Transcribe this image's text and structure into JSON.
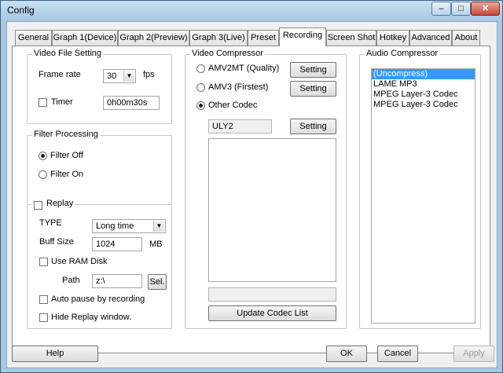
{
  "window": {
    "title": "Config"
  },
  "tabs": [
    "General",
    "Graph 1(Device)",
    "Graph 2(Preview)",
    "Graph 3(Live)",
    "Preset",
    "Recording",
    "Screen Shot",
    "Hotkey",
    "Advanced",
    "About"
  ],
  "active_tab": "Recording",
  "video_file_setting": {
    "legend": "Video File Setting",
    "frame_rate_label": "Frame rate",
    "frame_rate_value": "30",
    "fps_unit": "fps",
    "timer_label": "Timer",
    "timer_checked": false,
    "timer_value": "0h00m30s"
  },
  "filter_processing": {
    "legend": "Filter Processing",
    "filter_off_label": "Filter Off",
    "filter_on_label": "Filter On",
    "selected": "Filter Off"
  },
  "replay": {
    "legend": "Replay",
    "checked": false,
    "type_label": "TYPE",
    "type_value": "Long time",
    "buff_size_label": "Buff Size",
    "buff_size_value": "1024",
    "buff_size_unit": "MB",
    "use_ram_disk_label": "Use RAM Disk",
    "path_label": "Path",
    "path_value": "z:\\",
    "sel_button": "Sel.",
    "auto_pause_label": "Auto pause by recording",
    "hide_replay_label": "Hide Replay window."
  },
  "video_compressor": {
    "legend": "Video Compressor",
    "amv2mt_label": "AMV2MT (Quality)",
    "amv3_label": "AMV3 (Firstest)",
    "other_codec_label": "Other Codec",
    "selected": "Other Codec",
    "setting_button": "Setting",
    "codec_name": "ULY2",
    "update_button": "Update Codec List"
  },
  "audio_compressor": {
    "legend": "Audio Compressor",
    "items": [
      "(Uncompress)",
      "LAME MP3",
      "MPEG Layer-3 Codec",
      "MPEG Layer-3 Codec"
    ],
    "selected_index": 0
  },
  "footer": {
    "help": "Help",
    "ok": "OK",
    "cancel": "Cancel",
    "apply": "Apply"
  }
}
